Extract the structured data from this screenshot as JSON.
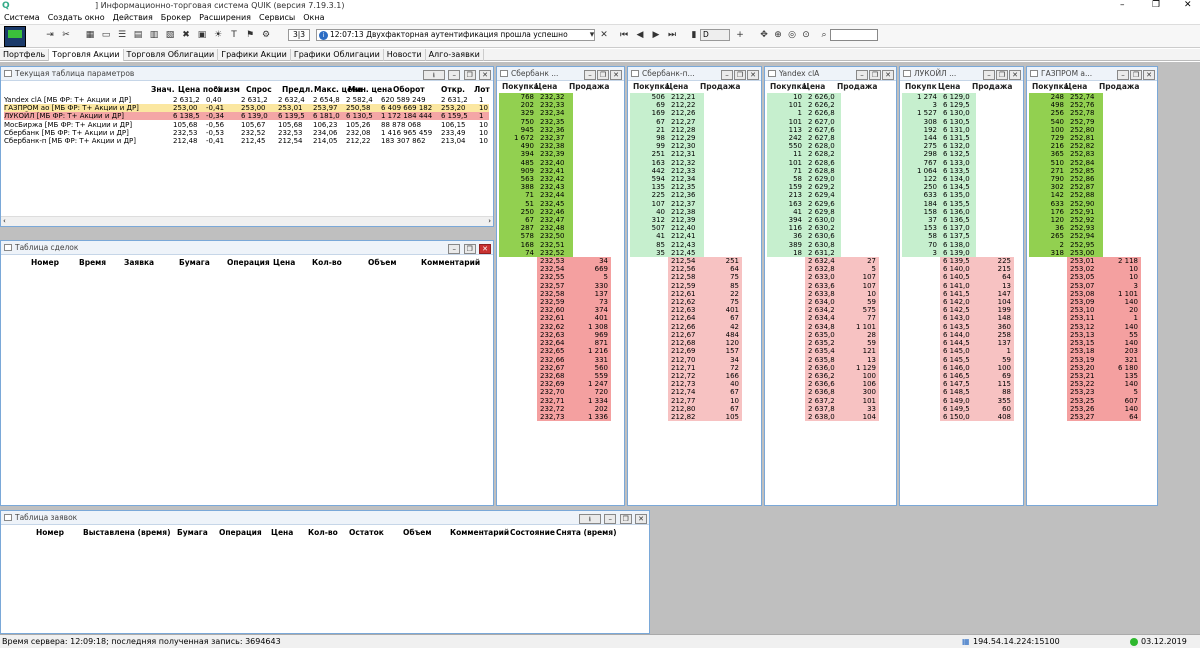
{
  "title": "] Информационно-торговая система QUIK (версия 7.19.3.1)",
  "menu": [
    "Система",
    "Создать окно",
    "Действия",
    "Брокер",
    "Расширения",
    "Сервисы",
    "Окна"
  ],
  "toolbar": {
    "page_counter": "3|3",
    "message_time": "12:07:13",
    "message_text": "Двухфакторная аутентификация прошла успешно",
    "interval": "D",
    "search_placeholder": ""
  },
  "tabs": [
    {
      "label": "Портфель",
      "active": false
    },
    {
      "label": "Торговля Акции",
      "active": true
    },
    {
      "label": "Торговля Облигации",
      "active": false
    },
    {
      "label": "Графики Акции",
      "active": false
    },
    {
      "label": "Графики Облигации",
      "active": false
    },
    {
      "label": "Новости",
      "active": false
    },
    {
      "label": "Алго-заявки",
      "active": false
    }
  ],
  "params": {
    "title": "Текущая таблица параметров",
    "columns": [
      "Знач.",
      "Цена посл.",
      "% изм",
      "Спрос",
      "Предл.",
      "Макс. цена",
      "Мин. цена",
      "Оборот",
      "Откр.",
      "Лот"
    ],
    "rows": [
      {
        "name": "Yandex clA [МБ ФР: Т+ Акции и ДР]",
        "vals": [
          "",
          "2 631,2",
          "0,40",
          "2 631,2",
          "2 632,4",
          "2 654,8",
          "2 582,4",
          "620 589 249",
          "2 631,2",
          "1"
        ],
        "bg": "#ffffff"
      },
      {
        "name": "ГАЗПРОМ ао [МБ ФР: Т+ Акции и ДР]",
        "vals": [
          "",
          "253,00",
          "-0,41",
          "253,00",
          "253,01",
          "253,97",
          "250,58",
          "6 409 669 182",
          "253,20",
          "10"
        ],
        "bg": "#fbe7a1"
      },
      {
        "name": "ЛУКОЙЛ [МБ ФР: Т+ Акции и ДР]",
        "vals": [
          "",
          "6 138,5",
          "-0,34",
          "6 139,0",
          "6 139,5",
          "6 181,0",
          "6 130,5",
          "1 172 184 444",
          "6 159,5",
          "1"
        ],
        "bg": "#f4a6a6"
      },
      {
        "name": "МосБиржа [МБ ФР: Т+ Акции и ДР]",
        "vals": [
          "",
          "105,68",
          "-0,56",
          "105,67",
          "105,68",
          "106,23",
          "105,26",
          "88 878 068",
          "106,15",
          "10"
        ],
        "bg": "#ffffff"
      },
      {
        "name": "Сбербанк [МБ ФР: Т+ Акции и ДР]",
        "vals": [
          "",
          "232,53",
          "-0,53",
          "232,52",
          "232,53",
          "234,06",
          "232,08",
          "1 416 965 459",
          "233,49",
          "10"
        ],
        "bg": "#ffffff"
      },
      {
        "name": "Сбербанк-п [МБ ФР: Т+ Акции и ДР]",
        "vals": [
          "",
          "212,48",
          "-0,41",
          "212,45",
          "212,54",
          "214,05",
          "212,22",
          "183 307 862",
          "213,04",
          "10"
        ],
        "bg": "#ffffff"
      }
    ]
  },
  "deals": {
    "title": "Таблица сделок",
    "columns": [
      "Номер",
      "Время",
      "Заявка",
      "Бумага",
      "Операция",
      "Цена",
      "Кол-во",
      "Объем",
      "Комментарий"
    ]
  },
  "orders": {
    "title": "Таблица заявок",
    "columns": [
      "Номер",
      "Выставлена (время)",
      "Бумага",
      "Операция",
      "Цена",
      "Кол-во",
      "Остаток",
      "Объем",
      "Комментарий",
      "Состояние",
      "Снята (время)"
    ]
  },
  "orderbooks": [
    {
      "title": "Сбербанк ...",
      "headers": [
        "Покупка",
        "Цена",
        "Продажа"
      ],
      "bids": [
        [
          "768",
          "232,32"
        ],
        [
          "202",
          "232,33"
        ],
        [
          "329",
          "232,34"
        ],
        [
          "750",
          "232,35"
        ],
        [
          "945",
          "232,36"
        ],
        [
          "1 672",
          "232,37"
        ],
        [
          "490",
          "232,38"
        ],
        [
          "394",
          "232,39"
        ],
        [
          "485",
          "232,40"
        ],
        [
          "909",
          "232,41"
        ],
        [
          "563",
          "232,42"
        ],
        [
          "388",
          "232,43"
        ],
        [
          "71",
          "232,44"
        ],
        [
          "51",
          "232,45"
        ],
        [
          "250",
          "232,46"
        ],
        [
          "67",
          "232,47"
        ],
        [
          "287",
          "232,48"
        ],
        [
          "578",
          "232,50"
        ],
        [
          "168",
          "232,51"
        ],
        [
          "74",
          "232,52"
        ]
      ],
      "asks": [
        [
          "232,53",
          "34"
        ],
        [
          "232,54",
          "669"
        ],
        [
          "232,55",
          "5"
        ],
        [
          "232,57",
          "330"
        ],
        [
          "232,58",
          "137"
        ],
        [
          "232,59",
          "73"
        ],
        [
          "232,60",
          "374"
        ],
        [
          "232,61",
          "401"
        ],
        [
          "232,62",
          "1 308"
        ],
        [
          "232,63",
          "969"
        ],
        [
          "232,64",
          "871"
        ],
        [
          "232,65",
          "1 216"
        ],
        [
          "232,66",
          "331"
        ],
        [
          "232,67",
          "560"
        ],
        [
          "232,68",
          "559"
        ],
        [
          "232,69",
          "1 247"
        ],
        [
          "232,70",
          "720"
        ],
        [
          "232,71",
          "1 334"
        ],
        [
          "232,72",
          "202"
        ],
        [
          "232,73",
          "1 336"
        ]
      ],
      "bid_color": "#92d050",
      "ask_color": "#f4a0a0"
    },
    {
      "title": "Сбербанк-п...",
      "headers": [
        "Покупка",
        "Цена",
        "Продажа"
      ],
      "bids": [
        [
          "506",
          "212,21"
        ],
        [
          "69",
          "212,22"
        ],
        [
          "169",
          "212,26"
        ],
        [
          "67",
          "212,27"
        ],
        [
          "21",
          "212,28"
        ],
        [
          "98",
          "212,29"
        ],
        [
          "99",
          "212,30"
        ],
        [
          "251",
          "212,31"
        ],
        [
          "163",
          "212,32"
        ],
        [
          "442",
          "212,33"
        ],
        [
          "594",
          "212,34"
        ],
        [
          "135",
          "212,35"
        ],
        [
          "225",
          "212,36"
        ],
        [
          "107",
          "212,37"
        ],
        [
          "40",
          "212,38"
        ],
        [
          "312",
          "212,39"
        ],
        [
          "507",
          "212,40"
        ],
        [
          "41",
          "212,41"
        ],
        [
          "85",
          "212,43"
        ],
        [
          "35",
          "212,45"
        ]
      ],
      "asks": [
        [
          "212,54",
          "251"
        ],
        [
          "212,56",
          "64"
        ],
        [
          "212,58",
          "75"
        ],
        [
          "212,59",
          "85"
        ],
        [
          "212,61",
          "22"
        ],
        [
          "212,62",
          "75"
        ],
        [
          "212,63",
          "401"
        ],
        [
          "212,64",
          "67"
        ],
        [
          "212,66",
          "42"
        ],
        [
          "212,67",
          "484"
        ],
        [
          "212,68",
          "120"
        ],
        [
          "212,69",
          "157"
        ],
        [
          "212,70",
          "34"
        ],
        [
          "212,71",
          "72"
        ],
        [
          "212,72",
          "166"
        ],
        [
          "212,73",
          "40"
        ],
        [
          "212,74",
          "67"
        ],
        [
          "212,77",
          "10"
        ],
        [
          "212,80",
          "67"
        ],
        [
          "212,82",
          "105"
        ]
      ],
      "bid_color": "#c6efce",
      "ask_color": "#f7c2c2"
    },
    {
      "title": "Yandex clA",
      "headers": [
        "Покупка",
        "Цена",
        "Продажа"
      ],
      "bids": [
        [
          "10",
          "2 626,0"
        ],
        [
          "101",
          "2 626,2"
        ],
        [
          "1",
          "2 626,8"
        ],
        [
          "101",
          "2 627,0"
        ],
        [
          "113",
          "2 627,6"
        ],
        [
          "242",
          "2 627,8"
        ],
        [
          "550",
          "2 628,0"
        ],
        [
          "11",
          "2 628,2"
        ],
        [
          "101",
          "2 628,6"
        ],
        [
          "71",
          "2 628,8"
        ],
        [
          "58",
          "2 629,0"
        ],
        [
          "159",
          "2 629,2"
        ],
        [
          "213",
          "2 629,4"
        ],
        [
          "163",
          "2 629,6"
        ],
        [
          "41",
          "2 629,8"
        ],
        [
          "394",
          "2 630,0"
        ],
        [
          "116",
          "2 630,2"
        ],
        [
          "36",
          "2 630,6"
        ],
        [
          "389",
          "2 630,8"
        ],
        [
          "18",
          "2 631,2"
        ]
      ],
      "asks": [
        [
          "2 632,4",
          "27"
        ],
        [
          "2 632,8",
          "5"
        ],
        [
          "2 633,0",
          "107"
        ],
        [
          "2 633,6",
          "107"
        ],
        [
          "2 633,8",
          "10"
        ],
        [
          "2 634,0",
          "59"
        ],
        [
          "2 634,2",
          "575"
        ],
        [
          "2 634,4",
          "77"
        ],
        [
          "2 634,8",
          "1 101"
        ],
        [
          "2 635,0",
          "28"
        ],
        [
          "2 635,2",
          "59"
        ],
        [
          "2 635,4",
          "121"
        ],
        [
          "2 635,8",
          "13"
        ],
        [
          "2 636,0",
          "1 129"
        ],
        [
          "2 636,2",
          "100"
        ],
        [
          "2 636,6",
          "106"
        ],
        [
          "2 636,8",
          "300"
        ],
        [
          "2 637,2",
          "101"
        ],
        [
          "2 637,8",
          "33"
        ],
        [
          "2 638,0",
          "104"
        ]
      ],
      "bid_color": "#c6efce",
      "ask_color": "#f7c2c2"
    },
    {
      "title": "ЛУКОЙЛ ...",
      "headers": [
        "Покупк",
        "Цена",
        "Продажа"
      ],
      "bids": [
        [
          "1 274",
          "6 129,0"
        ],
        [
          "3",
          "6 129,5"
        ],
        [
          "1 527",
          "6 130,0"
        ],
        [
          "308",
          "6 130,5"
        ],
        [
          "192",
          "6 131,0"
        ],
        [
          "144",
          "6 131,5"
        ],
        [
          "275",
          "6 132,0"
        ],
        [
          "298",
          "6 132,5"
        ],
        [
          "767",
          "6 133,0"
        ],
        [
          "1 064",
          "6 133,5"
        ],
        [
          "122",
          "6 134,0"
        ],
        [
          "250",
          "6 134,5"
        ],
        [
          "633",
          "6 135,0"
        ],
        [
          "184",
          "6 135,5"
        ],
        [
          "158",
          "6 136,0"
        ],
        [
          "37",
          "6 136,5"
        ],
        [
          "153",
          "6 137,0"
        ],
        [
          "58",
          "6 137,5"
        ],
        [
          "70",
          "6 138,0"
        ],
        [
          "3",
          "6 139,0"
        ]
      ],
      "asks": [
        [
          "6 139,5",
          "225"
        ],
        [
          "6 140,0",
          "215"
        ],
        [
          "6 140,5",
          "64"
        ],
        [
          "6 141,0",
          "13"
        ],
        [
          "6 141,5",
          "147"
        ],
        [
          "6 142,0",
          "104"
        ],
        [
          "6 142,5",
          "199"
        ],
        [
          "6 143,0",
          "148"
        ],
        [
          "6 143,5",
          "360"
        ],
        [
          "6 144,0",
          "258"
        ],
        [
          "6 144,5",
          "137"
        ],
        [
          "6 145,0",
          "1"
        ],
        [
          "6 145,5",
          "59"
        ],
        [
          "6 146,0",
          "100"
        ],
        [
          "6 146,5",
          "69"
        ],
        [
          "6 147,5",
          "115"
        ],
        [
          "6 148,5",
          "88"
        ],
        [
          "6 149,0",
          "355"
        ],
        [
          "6 149,5",
          "60"
        ],
        [
          "6 150,0",
          "408"
        ]
      ],
      "bid_color": "#c6efce",
      "ask_color": "#f7c2c2"
    },
    {
      "title": "ГАЗПРОМ а...",
      "headers": [
        "Покупка",
        "Цена",
        "Продажа"
      ],
      "bids": [
        [
          "248",
          "252,74"
        ],
        [
          "498",
          "252,76"
        ],
        [
          "256",
          "252,78"
        ],
        [
          "540",
          "252,79"
        ],
        [
          "100",
          "252,80"
        ],
        [
          "729",
          "252,81"
        ],
        [
          "216",
          "252,82"
        ],
        [
          "365",
          "252,83"
        ],
        [
          "510",
          "252,84"
        ],
        [
          "271",
          "252,85"
        ],
        [
          "790",
          "252,86"
        ],
        [
          "302",
          "252,87"
        ],
        [
          "142",
          "252,88"
        ],
        [
          "633",
          "252,90"
        ],
        [
          "176",
          "252,91"
        ],
        [
          "120",
          "252,92"
        ],
        [
          "36",
          "252,93"
        ],
        [
          "265",
          "252,94"
        ],
        [
          "2",
          "252,95"
        ],
        [
          "318",
          "253,00"
        ]
      ],
      "asks": [
        [
          "253,01",
          "2 118"
        ],
        [
          "253,02",
          "10"
        ],
        [
          "253,05",
          "10"
        ],
        [
          "253,07",
          "3"
        ],
        [
          "253,08",
          "1 101"
        ],
        [
          "253,09",
          "140"
        ],
        [
          "253,10",
          "20"
        ],
        [
          "253,11",
          "1"
        ],
        [
          "253,12",
          "140"
        ],
        [
          "253,13",
          "55"
        ],
        [
          "253,15",
          "140"
        ],
        [
          "253,18",
          "203"
        ],
        [
          "253,19",
          "321"
        ],
        [
          "253,20",
          "6 180"
        ],
        [
          "253,21",
          "135"
        ],
        [
          "253,22",
          "140"
        ],
        [
          "253,23",
          "5"
        ],
        [
          "253,25",
          "607"
        ],
        [
          "253,26",
          "140"
        ],
        [
          "253,27",
          "64"
        ]
      ],
      "bid_color": "#92d050",
      "ask_color": "#f4a0a0"
    }
  ],
  "status": {
    "server_time": "Время сервера: 12:09:18; последняя полученная запись: 3694643",
    "server_addr": "194.54.14.224:15100",
    "date": "03.12.2019"
  }
}
